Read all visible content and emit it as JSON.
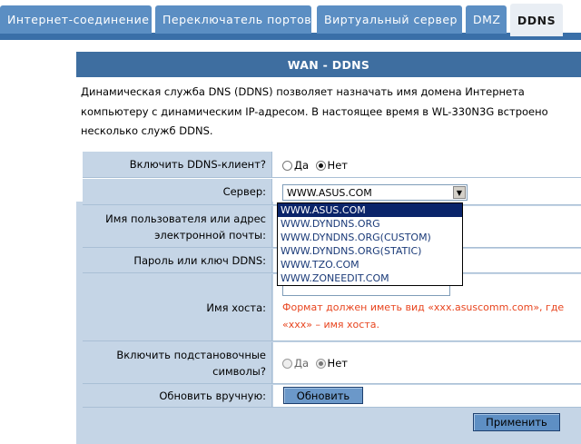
{
  "tabs": [
    {
      "label": "Интернет-соединение",
      "active": false
    },
    {
      "label": "Переключатель портов",
      "active": false
    },
    {
      "label": "Виртуальный сервер",
      "active": false
    },
    {
      "label": "DMZ",
      "active": false
    },
    {
      "label": "DDNS",
      "active": true
    }
  ],
  "panel": {
    "title": "WAN - DDNS",
    "description": "Динамическая служба DNS (DDNS) позволяет назначать имя домена Интернета компьютеру с динамическим IP-адресом. В настоящее время в WL-330N3G встроено несколько служб DDNS."
  },
  "form": {
    "enable_client": {
      "label": "Включить DDNS-клиент?",
      "yes": "Да",
      "no": "Нет",
      "selected": "Нет"
    },
    "server": {
      "label": "Сервер:",
      "value": "WWW.ASUS.COM",
      "options": [
        "WWW.ASUS.COM",
        "WWW.DYNDNS.ORG",
        "WWW.DYNDNS.ORG(CUSTOM)",
        "WWW.DYNDNS.ORG(STATIC)",
        "WWW.TZO.COM",
        "WWW.ZONEEDIT.COM"
      ]
    },
    "username": {
      "label": "Имя пользователя или адрес электронной почты:",
      "value": ""
    },
    "password": {
      "label": "Пароль или ключ DDNS:",
      "value": ""
    },
    "hostname": {
      "label": "Имя хоста:",
      "value": "",
      "hint": "Формат должен иметь вид «xxx.asuscomm.com», где «xxx» – имя хоста."
    },
    "wildcard": {
      "label": "Включить подстановочные символы?",
      "yes": "Да",
      "no": "Нет",
      "selected": "Нет"
    },
    "manual_update": {
      "label": "Обновить вручную:",
      "button": "Обновить"
    },
    "apply_button": "Применить"
  },
  "colors": {
    "tab": "#5b8ec3",
    "tab_active": "#e9eef4",
    "panel_title": "#3e6ea0",
    "panel_bg": "#c5d5e6",
    "hint": "#e8451f",
    "option_selected": "#0a246a"
  }
}
